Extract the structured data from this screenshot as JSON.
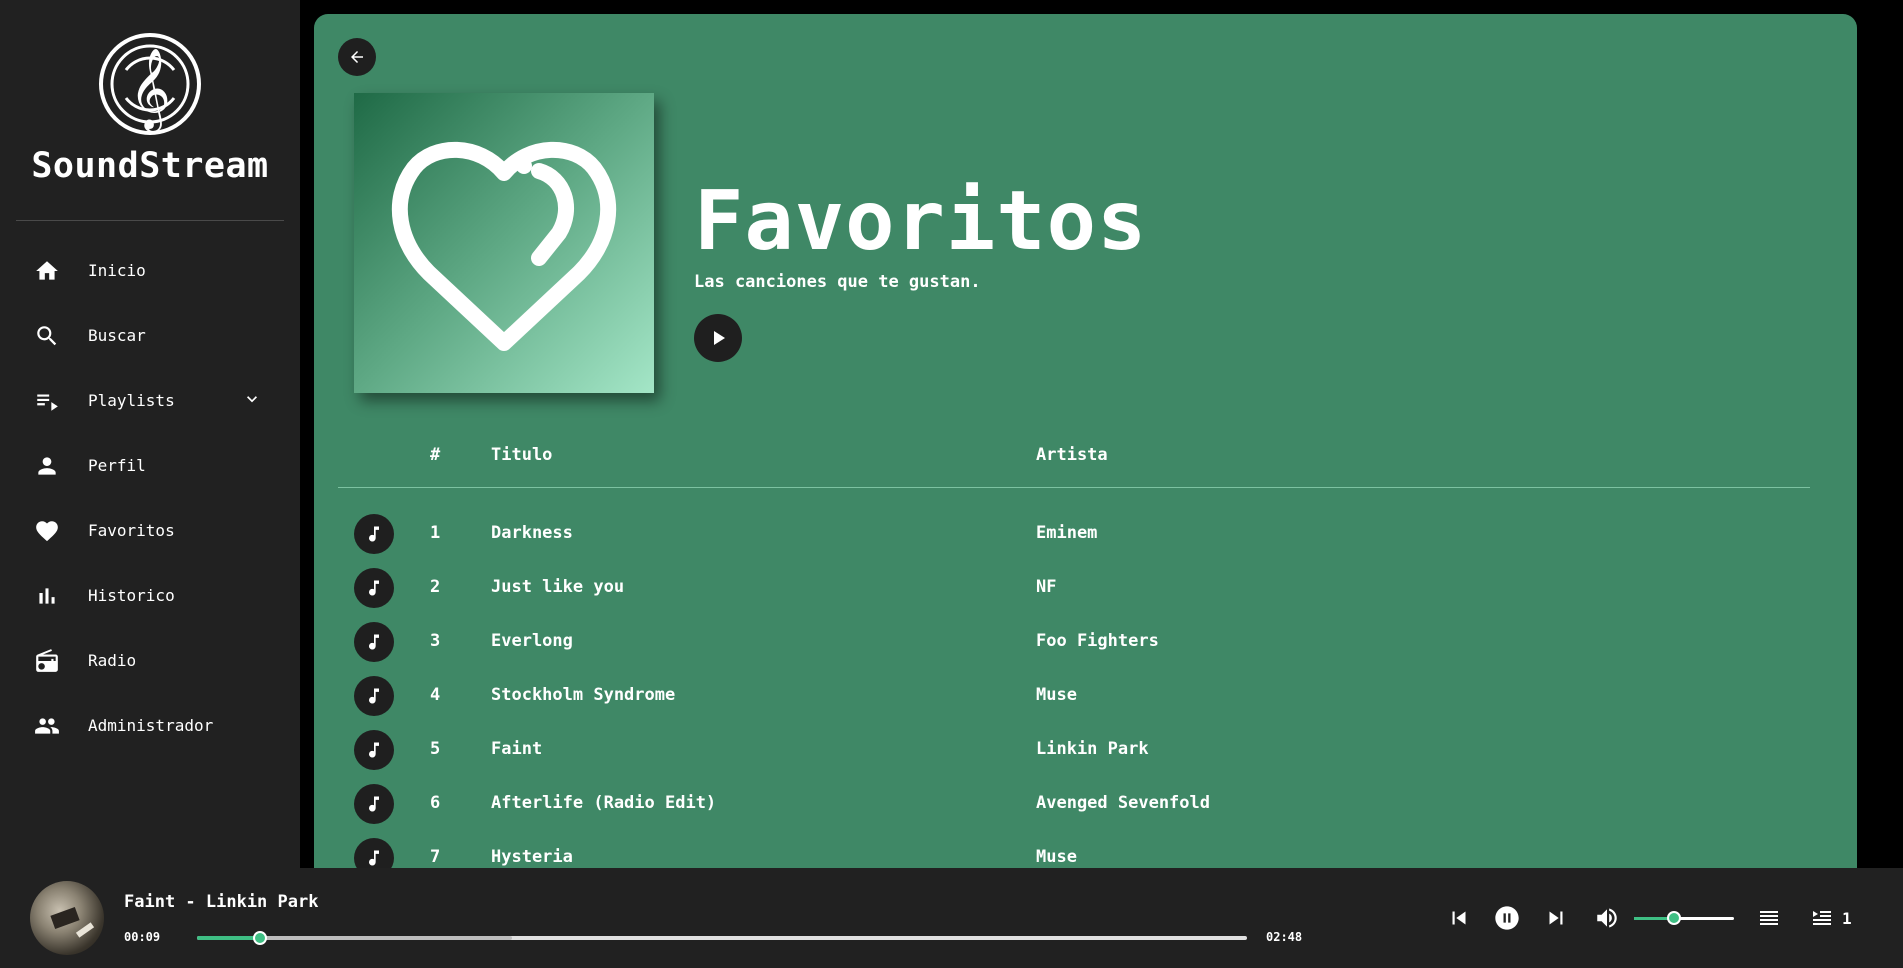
{
  "app": {
    "name": "SoundStream"
  },
  "sidebar": {
    "items": [
      {
        "label": "Inicio",
        "icon": "home-icon"
      },
      {
        "label": "Buscar",
        "icon": "search-icon"
      },
      {
        "label": "Playlists",
        "icon": "playlist-icon"
      },
      {
        "label": "Perfil",
        "icon": "person-icon"
      },
      {
        "label": "Favoritos",
        "icon": "heart-icon"
      },
      {
        "label": "Historico",
        "icon": "bar-chart-icon"
      },
      {
        "label": "Radio",
        "icon": "radio-icon"
      },
      {
        "label": "Administrador",
        "icon": "people-icon"
      }
    ]
  },
  "playlist": {
    "title": "Favoritos",
    "description": "Las canciones que te gustan.",
    "columns": {
      "number": "#",
      "title": "Titulo",
      "artist": "Artista"
    },
    "tracks": [
      {
        "number": "1",
        "title": "Darkness",
        "artist": "Eminem"
      },
      {
        "number": "2",
        "title": "Just like you",
        "artist": "NF"
      },
      {
        "number": "3",
        "title": "Everlong",
        "artist": "Foo Fighters"
      },
      {
        "number": "4",
        "title": "Stockholm Syndrome",
        "artist": "Muse"
      },
      {
        "number": "5",
        "title": "Faint",
        "artist": "Linkin Park"
      },
      {
        "number": "6",
        "title": "Afterlife (Radio Edit)",
        "artist": "Avenged Sevenfold"
      },
      {
        "number": "7",
        "title": "Hysteria",
        "artist": "Muse"
      }
    ]
  },
  "player": {
    "now_playing": "Faint - Linkin Park",
    "current_time": "00:09",
    "total_time": "02:48",
    "progress": 0.06,
    "buffered": 0.3,
    "volume": 0.4,
    "queue_count": "1"
  },
  "colors": {
    "sidebar_bg": "#212121",
    "main_bg": "#3f8866",
    "accent": "#3fbf84",
    "button_bg": "#1f1f1f"
  }
}
